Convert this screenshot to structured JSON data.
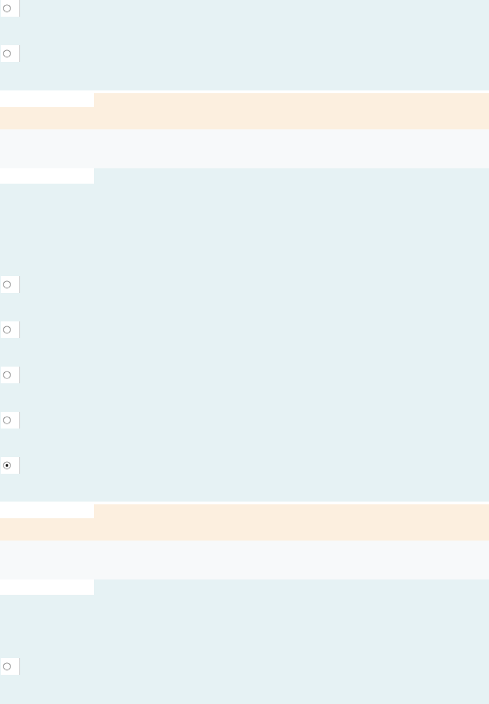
{
  "blocks": [
    {
      "kind": "choices",
      "options": [
        {
          "selected": false
        },
        {
          "selected": false
        }
      ]
    },
    {
      "kind": "divider"
    },
    {
      "kind": "choices",
      "options": [
        {
          "selected": false
        },
        {
          "selected": false
        },
        {
          "selected": false
        },
        {
          "selected": false
        },
        {
          "selected": true
        }
      ]
    },
    {
      "kind": "divider"
    },
    {
      "kind": "choices",
      "options": [
        {
          "selected": false
        }
      ]
    }
  ]
}
